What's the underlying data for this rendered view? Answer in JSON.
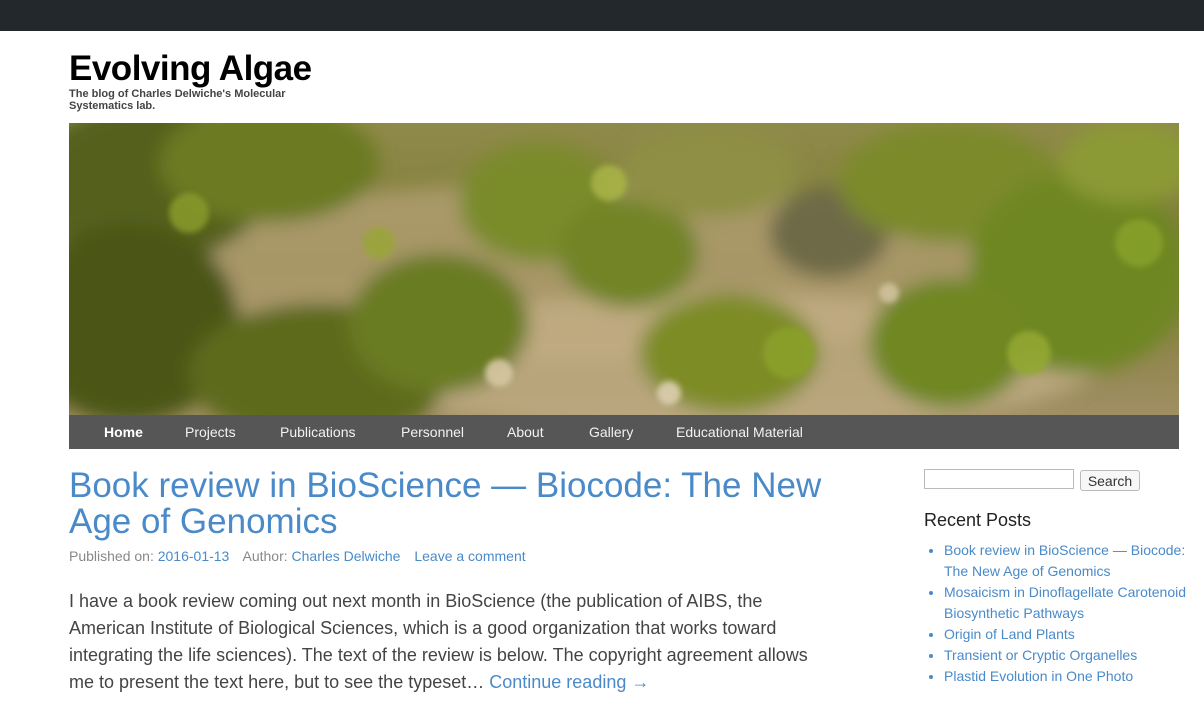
{
  "site": {
    "title": "Evolving Algae",
    "tagline": "The blog of Charles Delwiche's Molecular Systematics lab."
  },
  "nav": {
    "items": [
      {
        "label": "Home",
        "active": true
      },
      {
        "label": "Projects"
      },
      {
        "label": "Publications"
      },
      {
        "label": "Personnel"
      },
      {
        "label": "About"
      },
      {
        "label": "Gallery"
      },
      {
        "label": "Educational Material"
      }
    ]
  },
  "post": {
    "title": "Book review in BioScience — Biocode: The New Age of Genomics",
    "published_label": "Published on:",
    "date": "2016-01-13",
    "author_label": "Author:",
    "author": "Charles Delwiche",
    "comment_link": "Leave a comment",
    "excerpt": "I have a book review coming out next month in BioScience (the publication of AIBS, the American Institute of Biological Sciences, which is a good organization that works toward integrating the life sciences). The text of the review is below. The copyright agreement allows me to present the text here, but to see the typeset… ",
    "continue_link": "Continue reading →"
  },
  "sidebar": {
    "search_button": "Search",
    "search_value": "",
    "recent_title": "Recent Posts",
    "recent_posts": [
      "Book review in BioScience — Biocode: The New Age of Genomics",
      "Mosaicism in Dinoflagellate Carotenoid Biosynthetic Pathways",
      "Origin of Land Plants",
      "Transient or Cryptic Organelles",
      "Plastid Evolution in One Photo"
    ]
  },
  "colors": {
    "top_bar": "#23282d",
    "nav_bar": "#565656",
    "link": "#4a8ac8"
  }
}
